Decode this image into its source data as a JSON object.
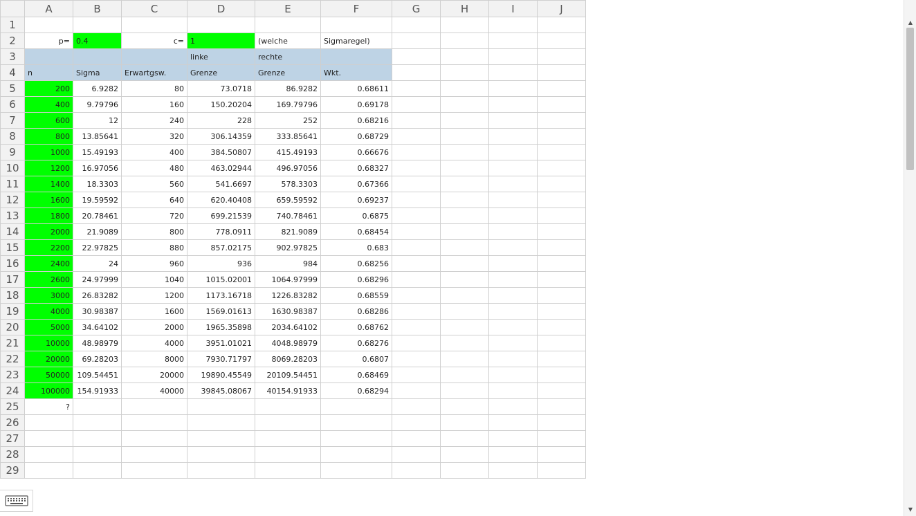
{
  "columns": [
    "A",
    "B",
    "C",
    "D",
    "E",
    "F",
    "G",
    "H",
    "I",
    "J"
  ],
  "cells": {
    "A2": "p=",
    "B2": "0.4",
    "C2": "c=",
    "D2": "1",
    "E2": "(welche",
    "F2": "Sigmaregel)",
    "D3": "linke",
    "E3": "rechte",
    "A4": "n",
    "B4": "Sigma",
    "C4": "Erwartgsw.",
    "D4": "Grenze",
    "E4": "Grenze",
    "F4": "Wkt.",
    "A5": "200",
    "B5": "6.9282",
    "C5": "80",
    "D5": "73.0718",
    "E5": "86.9282",
    "F5": "0.68611",
    "A6": "400",
    "B6": "9.79796",
    "C6": "160",
    "D6": "150.20204",
    "E6": "169.79796",
    "F6": "0.69178",
    "A7": "600",
    "B7": "12",
    "C7": "240",
    "D7": "228",
    "E7": "252",
    "F7": "0.68216",
    "A8": "800",
    "B8": "13.85641",
    "C8": "320",
    "D8": "306.14359",
    "E8": "333.85641",
    "F8": "0.68729",
    "A9": "1000",
    "B9": "15.49193",
    "C9": "400",
    "D9": "384.50807",
    "E9": "415.49193",
    "F9": "0.66676",
    "A10": "1200",
    "B10": "16.97056",
    "C10": "480",
    "D10": "463.02944",
    "E10": "496.97056",
    "F10": "0.68327",
    "A11": "1400",
    "B11": "18.3303",
    "C11": "560",
    "D11": "541.6697",
    "E11": "578.3303",
    "F11": "0.67366",
    "A12": "1600",
    "B12": "19.59592",
    "C12": "640",
    "D12": "620.40408",
    "E12": "659.59592",
    "F12": "0.69237",
    "A13": "1800",
    "B13": "20.78461",
    "C13": "720",
    "D13": "699.21539",
    "E13": "740.78461",
    "F13": "0.6875",
    "A14": "2000",
    "B14": "21.9089",
    "C14": "800",
    "D14": "778.0911",
    "E14": "821.9089",
    "F14": "0.68454",
    "A15": "2200",
    "B15": "22.97825",
    "C15": "880",
    "D15": "857.02175",
    "E15": "902.97825",
    "F15": "0.683",
    "A16": "2400",
    "B16": "24",
    "C16": "960",
    "D16": "936",
    "E16": "984",
    "F16": "0.68256",
    "A17": "2600",
    "B17": "24.97999",
    "C17": "1040",
    "D17": "1015.02001",
    "E17": "1064.97999",
    "F17": "0.68296",
    "A18": "3000",
    "B18": "26.83282",
    "C18": "1200",
    "D18": "1173.16718",
    "E18": "1226.83282",
    "F18": "0.68559",
    "A19": "4000",
    "B19": "30.98387",
    "C19": "1600",
    "D19": "1569.01613",
    "E19": "1630.98387",
    "F19": "0.68286",
    "A20": "5000",
    "B20": "34.64102",
    "C20": "2000",
    "D20": "1965.35898",
    "E20": "2034.64102",
    "F20": "0.68762",
    "A21": "10000",
    "B21": "48.98979",
    "C21": "4000",
    "D21": "3951.01021",
    "E21": "4048.98979",
    "F21": "0.68276",
    "A22": "20000",
    "B22": "69.28203",
    "C22": "8000",
    "D22": "7930.71797",
    "E22": "8069.28203",
    "F22": "0.6807",
    "A23": "50000",
    "B23": "109.54451",
    "C23": "20000",
    "D23": "19890.45549",
    "E23": "20109.54451",
    "F23": "0.68469",
    "A24": "100000",
    "B24": "154.91933",
    "C24": "40000",
    "D24": "39845.08067",
    "E24": "40154.91933",
    "F24": "0.68294",
    "A25": "?"
  },
  "colors": {
    "input_green": "#00ff00",
    "header_blue": "#bed3e5"
  },
  "icons": {
    "keyboard": "keyboard-icon",
    "scroll_up": "chevron-up-icon",
    "scroll_down": "chevron-down-icon"
  }
}
